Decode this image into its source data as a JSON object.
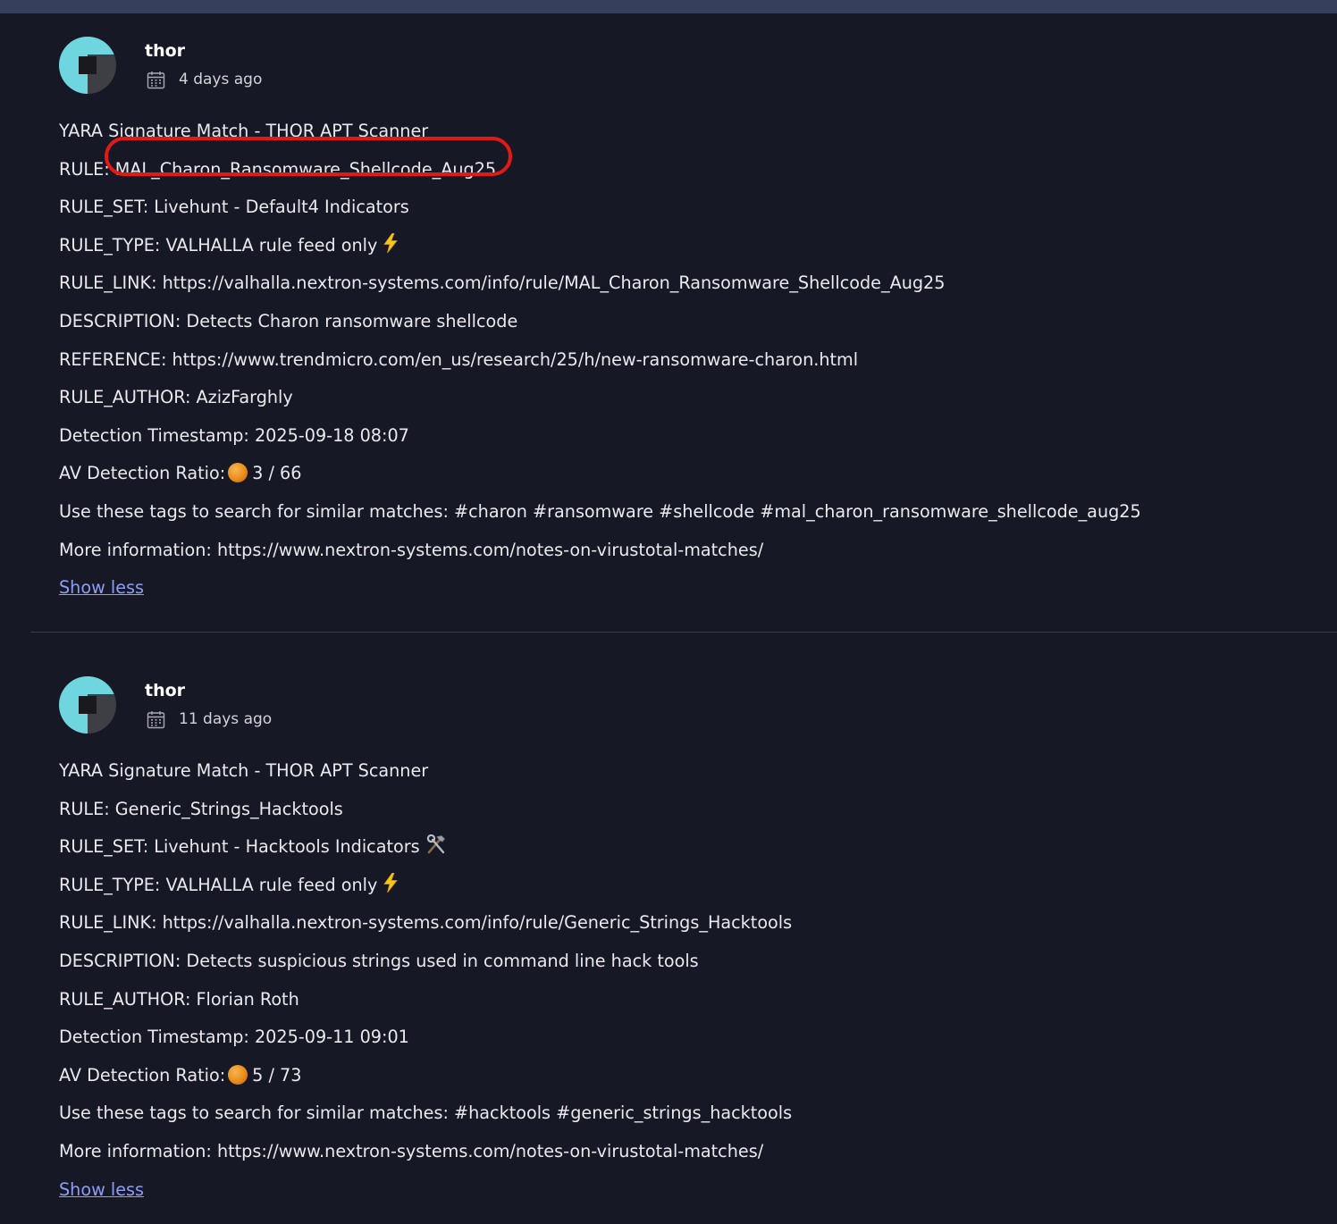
{
  "comments": [
    {
      "author": "thor",
      "date": "4 days ago",
      "lines": [
        "YARA Signature Match - THOR APT Scanner",
        "RULE: MAL_Charon_Ransomware_Shellcode_Aug25",
        "RULE_SET: Livehunt - Default4 Indicators",
        "RULE_TYPE: VALHALLA rule feed only",
        "RULE_LINK: https://valhalla.nextron-systems.com/info/rule/MAL_Charon_Ransomware_Shellcode_Aug25",
        "DESCRIPTION: Detects Charon ransomware shellcode",
        "REFERENCE: https://www.trendmicro.com/en_us/research/25/h/new-ransomware-charon.html",
        "RULE_AUTHOR: AzizFarghly",
        "Detection Timestamp: 2025-09-18 08:07",
        "AV Detection Ratio:",
        "Use these tags to search for similar matches: #charon #ransomware #shellcode #mal_charon_ransomware_shellcode_aug25",
        "More information: https://www.nextron-systems.com/notes-on-virustotal-matches/"
      ],
      "av_ratio": "3 / 66",
      "rule_type_icon": "lightning-icon",
      "highlight_color": "#e31a14",
      "show_less": "Show less"
    },
    {
      "author": "thor",
      "date": "11 days ago",
      "lines": [
        "YARA Signature Match - THOR APT Scanner",
        "RULE: Generic_Strings_Hacktools",
        "RULE_SET: Livehunt - Hacktools Indicators",
        "RULE_TYPE: VALHALLA rule feed only",
        "RULE_LINK: https://valhalla.nextron-systems.com/info/rule/Generic_Strings_Hacktools",
        "DESCRIPTION: Detects suspicious strings used in command line hack tools",
        "RULE_AUTHOR: Florian Roth",
        "Detection Timestamp: 2025-09-11 09:01",
        "AV Detection Ratio:",
        "Use these tags to search for similar matches: #hacktools #generic_strings_hacktools",
        "More information: https://www.nextron-systems.com/notes-on-virustotal-matches/"
      ],
      "av_ratio": "5 / 73",
      "rule_set_icon": "hammer-and-wrench-icon",
      "rule_type_icon": "lightning-icon",
      "show_less": "Show less"
    }
  ],
  "colors": {
    "background": "#171825",
    "top_bar": "#363f5c",
    "link": "#8e9ef4",
    "avatar_teal": "#6fd6df",
    "avatar_dark": "#3d3f45",
    "av_orb": "#ea8d19"
  }
}
